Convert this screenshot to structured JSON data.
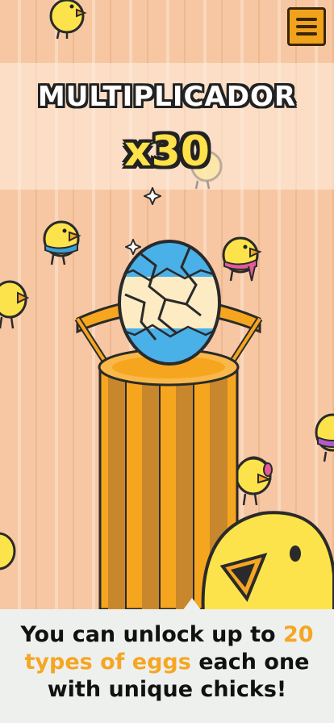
{
  "hud": {
    "title": "MULTIPLICADOR",
    "multiplier": "x30",
    "menu_icon": "hamburger-menu-icon"
  },
  "caption": {
    "part1": "You can unlock up to ",
    "highlight1": "20",
    "part2": " types of eggs",
    "highlight2_prefix": "",
    "part3": " each one with unique chicks!",
    "line1_a": "You can unlock up to ",
    "line1_b": "20",
    "line2_a": "types of eggs",
    "line2_b": " each one",
    "line3": "with unique chicks!"
  },
  "colors": {
    "accent": "#f5a623",
    "multiplier": "#ffe14a",
    "egg_top": "#4ab0e8",
    "egg_mid": "#fdebc4",
    "pedestal": "#f6a51f"
  }
}
